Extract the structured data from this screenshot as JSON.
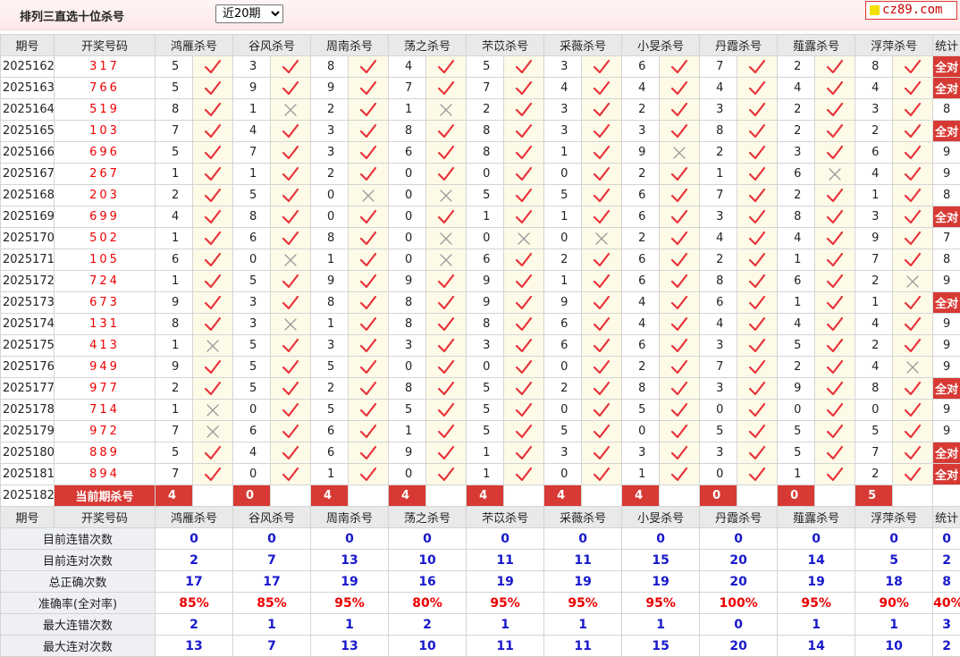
{
  "page": {
    "title": "排列三直选十位杀号",
    "period_select": "近20期",
    "logo": "cz89.com"
  },
  "columns": [
    "期号",
    "开奖号码",
    "鸿雁杀号",
    "谷风杀号",
    "周南杀号",
    "荡之杀号",
    "芣苡杀号",
    "采薇杀号",
    "小旻杀号",
    "丹霞杀号",
    "薤露杀号",
    "浮萍杀号",
    "统计"
  ],
  "rows": [
    {
      "period": "2025162",
      "draw": "317",
      "picks": [
        {
          "n": "5",
          "ok": true
        },
        {
          "n": "3",
          "ok": true
        },
        {
          "n": "8",
          "ok": true
        },
        {
          "n": "4",
          "ok": true
        },
        {
          "n": "5",
          "ok": true
        },
        {
          "n": "3",
          "ok": true
        },
        {
          "n": "6",
          "ok": true
        },
        {
          "n": "7",
          "ok": true
        },
        {
          "n": "2",
          "ok": true
        },
        {
          "n": "8",
          "ok": true
        }
      ],
      "total": "全对"
    },
    {
      "period": "2025163",
      "draw": "766",
      "picks": [
        {
          "n": "5",
          "ok": true
        },
        {
          "n": "9",
          "ok": true
        },
        {
          "n": "9",
          "ok": true
        },
        {
          "n": "7",
          "ok": true
        },
        {
          "n": "7",
          "ok": true
        },
        {
          "n": "4",
          "ok": true
        },
        {
          "n": "4",
          "ok": true
        },
        {
          "n": "4",
          "ok": true
        },
        {
          "n": "4",
          "ok": true
        },
        {
          "n": "4",
          "ok": true
        }
      ],
      "total": "全对"
    },
    {
      "period": "2025164",
      "draw": "519",
      "picks": [
        {
          "n": "8",
          "ok": true
        },
        {
          "n": "1",
          "ok": false
        },
        {
          "n": "2",
          "ok": true
        },
        {
          "n": "1",
          "ok": false
        },
        {
          "n": "2",
          "ok": true
        },
        {
          "n": "3",
          "ok": true
        },
        {
          "n": "2",
          "ok": true
        },
        {
          "n": "3",
          "ok": true
        },
        {
          "n": "2",
          "ok": true
        },
        {
          "n": "3",
          "ok": true
        }
      ],
      "total": "8"
    },
    {
      "period": "2025165",
      "draw": "103",
      "picks": [
        {
          "n": "7",
          "ok": true
        },
        {
          "n": "4",
          "ok": true
        },
        {
          "n": "3",
          "ok": true
        },
        {
          "n": "8",
          "ok": true
        },
        {
          "n": "8",
          "ok": true
        },
        {
          "n": "3",
          "ok": true
        },
        {
          "n": "3",
          "ok": true
        },
        {
          "n": "8",
          "ok": true
        },
        {
          "n": "2",
          "ok": true
        },
        {
          "n": "2",
          "ok": true
        }
      ],
      "total": "全对"
    },
    {
      "period": "2025166",
      "draw": "696",
      "picks": [
        {
          "n": "5",
          "ok": true
        },
        {
          "n": "7",
          "ok": true
        },
        {
          "n": "3",
          "ok": true
        },
        {
          "n": "6",
          "ok": true
        },
        {
          "n": "8",
          "ok": true
        },
        {
          "n": "1",
          "ok": true
        },
        {
          "n": "9",
          "ok": false
        },
        {
          "n": "2",
          "ok": true
        },
        {
          "n": "3",
          "ok": true
        },
        {
          "n": "6",
          "ok": true
        }
      ],
      "total": "9"
    },
    {
      "period": "2025167",
      "draw": "267",
      "picks": [
        {
          "n": "1",
          "ok": true
        },
        {
          "n": "1",
          "ok": true
        },
        {
          "n": "2",
          "ok": true
        },
        {
          "n": "0",
          "ok": true
        },
        {
          "n": "0",
          "ok": true
        },
        {
          "n": "0",
          "ok": true
        },
        {
          "n": "2",
          "ok": true
        },
        {
          "n": "1",
          "ok": true
        },
        {
          "n": "6",
          "ok": false
        },
        {
          "n": "4",
          "ok": true
        }
      ],
      "total": "9"
    },
    {
      "period": "2025168",
      "draw": "203",
      "picks": [
        {
          "n": "2",
          "ok": true
        },
        {
          "n": "5",
          "ok": true
        },
        {
          "n": "0",
          "ok": false
        },
        {
          "n": "0",
          "ok": false
        },
        {
          "n": "5",
          "ok": true
        },
        {
          "n": "5",
          "ok": true
        },
        {
          "n": "6",
          "ok": true
        },
        {
          "n": "7",
          "ok": true
        },
        {
          "n": "2",
          "ok": true
        },
        {
          "n": "1",
          "ok": true
        }
      ],
      "total": "8"
    },
    {
      "period": "2025169",
      "draw": "699",
      "picks": [
        {
          "n": "4",
          "ok": true
        },
        {
          "n": "8",
          "ok": true
        },
        {
          "n": "0",
          "ok": true
        },
        {
          "n": "0",
          "ok": true
        },
        {
          "n": "1",
          "ok": true
        },
        {
          "n": "1",
          "ok": true
        },
        {
          "n": "6",
          "ok": true
        },
        {
          "n": "3",
          "ok": true
        },
        {
          "n": "8",
          "ok": true
        },
        {
          "n": "3",
          "ok": true
        }
      ],
      "total": "全对"
    },
    {
      "period": "2025170",
      "draw": "502",
      "picks": [
        {
          "n": "1",
          "ok": true
        },
        {
          "n": "6",
          "ok": true
        },
        {
          "n": "8",
          "ok": true
        },
        {
          "n": "0",
          "ok": false
        },
        {
          "n": "0",
          "ok": false
        },
        {
          "n": "0",
          "ok": false
        },
        {
          "n": "2",
          "ok": true
        },
        {
          "n": "4",
          "ok": true
        },
        {
          "n": "4",
          "ok": true
        },
        {
          "n": "9",
          "ok": true
        }
      ],
      "total": "7"
    },
    {
      "period": "2025171",
      "draw": "105",
      "picks": [
        {
          "n": "6",
          "ok": true
        },
        {
          "n": "0",
          "ok": false
        },
        {
          "n": "1",
          "ok": true
        },
        {
          "n": "0",
          "ok": false
        },
        {
          "n": "6",
          "ok": true
        },
        {
          "n": "2",
          "ok": true
        },
        {
          "n": "6",
          "ok": true
        },
        {
          "n": "2",
          "ok": true
        },
        {
          "n": "1",
          "ok": true
        },
        {
          "n": "7",
          "ok": true
        }
      ],
      "total": "8"
    },
    {
      "period": "2025172",
      "draw": "724",
      "picks": [
        {
          "n": "1",
          "ok": true
        },
        {
          "n": "5",
          "ok": true
        },
        {
          "n": "9",
          "ok": true
        },
        {
          "n": "9",
          "ok": true
        },
        {
          "n": "9",
          "ok": true
        },
        {
          "n": "1",
          "ok": true
        },
        {
          "n": "6",
          "ok": true
        },
        {
          "n": "8",
          "ok": true
        },
        {
          "n": "6",
          "ok": true
        },
        {
          "n": "2",
          "ok": false
        }
      ],
      "total": "9"
    },
    {
      "period": "2025173",
      "draw": "673",
      "picks": [
        {
          "n": "9",
          "ok": true
        },
        {
          "n": "3",
          "ok": true
        },
        {
          "n": "8",
          "ok": true
        },
        {
          "n": "8",
          "ok": true
        },
        {
          "n": "9",
          "ok": true
        },
        {
          "n": "9",
          "ok": true
        },
        {
          "n": "4",
          "ok": true
        },
        {
          "n": "6",
          "ok": true
        },
        {
          "n": "1",
          "ok": true
        },
        {
          "n": "1",
          "ok": true
        }
      ],
      "total": "全对"
    },
    {
      "period": "2025174",
      "draw": "131",
      "picks": [
        {
          "n": "8",
          "ok": true
        },
        {
          "n": "3",
          "ok": false
        },
        {
          "n": "1",
          "ok": true
        },
        {
          "n": "8",
          "ok": true
        },
        {
          "n": "8",
          "ok": true
        },
        {
          "n": "6",
          "ok": true
        },
        {
          "n": "4",
          "ok": true
        },
        {
          "n": "4",
          "ok": true
        },
        {
          "n": "4",
          "ok": true
        },
        {
          "n": "4",
          "ok": true
        }
      ],
      "total": "9"
    },
    {
      "period": "2025175",
      "draw": "413",
      "picks": [
        {
          "n": "1",
          "ok": false
        },
        {
          "n": "5",
          "ok": true
        },
        {
          "n": "3",
          "ok": true
        },
        {
          "n": "3",
          "ok": true
        },
        {
          "n": "3",
          "ok": true
        },
        {
          "n": "6",
          "ok": true
        },
        {
          "n": "6",
          "ok": true
        },
        {
          "n": "3",
          "ok": true
        },
        {
          "n": "5",
          "ok": true
        },
        {
          "n": "2",
          "ok": true
        }
      ],
      "total": "9"
    },
    {
      "period": "2025176",
      "draw": "949",
      "picks": [
        {
          "n": "9",
          "ok": true
        },
        {
          "n": "5",
          "ok": true
        },
        {
          "n": "5",
          "ok": true
        },
        {
          "n": "0",
          "ok": true
        },
        {
          "n": "0",
          "ok": true
        },
        {
          "n": "0",
          "ok": true
        },
        {
          "n": "2",
          "ok": true
        },
        {
          "n": "7",
          "ok": true
        },
        {
          "n": "2",
          "ok": true
        },
        {
          "n": "4",
          "ok": false
        }
      ],
      "total": "9"
    },
    {
      "period": "2025177",
      "draw": "977",
      "picks": [
        {
          "n": "2",
          "ok": true
        },
        {
          "n": "5",
          "ok": true
        },
        {
          "n": "2",
          "ok": true
        },
        {
          "n": "8",
          "ok": true
        },
        {
          "n": "5",
          "ok": true
        },
        {
          "n": "2",
          "ok": true
        },
        {
          "n": "8",
          "ok": true
        },
        {
          "n": "3",
          "ok": true
        },
        {
          "n": "9",
          "ok": true
        },
        {
          "n": "8",
          "ok": true
        }
      ],
      "total": "全对"
    },
    {
      "period": "2025178",
      "draw": "714",
      "picks": [
        {
          "n": "1",
          "ok": false
        },
        {
          "n": "0",
          "ok": true
        },
        {
          "n": "5",
          "ok": true
        },
        {
          "n": "5",
          "ok": true
        },
        {
          "n": "5",
          "ok": true
        },
        {
          "n": "0",
          "ok": true
        },
        {
          "n": "5",
          "ok": true
        },
        {
          "n": "0",
          "ok": true
        },
        {
          "n": "0",
          "ok": true
        },
        {
          "n": "0",
          "ok": true
        }
      ],
      "total": "9"
    },
    {
      "period": "2025179",
      "draw": "972",
      "picks": [
        {
          "n": "7",
          "ok": false
        },
        {
          "n": "6",
          "ok": true
        },
        {
          "n": "6",
          "ok": true
        },
        {
          "n": "1",
          "ok": true
        },
        {
          "n": "5",
          "ok": true
        },
        {
          "n": "5",
          "ok": true
        },
        {
          "n": "0",
          "ok": true
        },
        {
          "n": "5",
          "ok": true
        },
        {
          "n": "5",
          "ok": true
        },
        {
          "n": "5",
          "ok": true
        }
      ],
      "total": "9"
    },
    {
      "period": "2025180",
      "draw": "889",
      "picks": [
        {
          "n": "5",
          "ok": true
        },
        {
          "n": "4",
          "ok": true
        },
        {
          "n": "6",
          "ok": true
        },
        {
          "n": "9",
          "ok": true
        },
        {
          "n": "1",
          "ok": true
        },
        {
          "n": "3",
          "ok": true
        },
        {
          "n": "3",
          "ok": true
        },
        {
          "n": "3",
          "ok": true
        },
        {
          "n": "5",
          "ok": true
        },
        {
          "n": "7",
          "ok": true
        }
      ],
      "total": "全对"
    },
    {
      "period": "2025181",
      "draw": "894",
      "picks": [
        {
          "n": "7",
          "ok": true
        },
        {
          "n": "0",
          "ok": true
        },
        {
          "n": "1",
          "ok": true
        },
        {
          "n": "0",
          "ok": true
        },
        {
          "n": "1",
          "ok": true
        },
        {
          "n": "0",
          "ok": true
        },
        {
          "n": "1",
          "ok": true
        },
        {
          "n": "0",
          "ok": true
        },
        {
          "n": "1",
          "ok": true
        },
        {
          "n": "2",
          "ok": true
        }
      ],
      "total": "全对"
    }
  ],
  "current": {
    "period": "2025182",
    "label": "当前期杀号",
    "values": [
      "4",
      "0",
      "4",
      "4",
      "4",
      "4",
      "4",
      "0",
      "0",
      "5"
    ]
  },
  "stats": [
    {
      "label": "目前连错次数",
      "values": [
        "0",
        "0",
        "0",
        "0",
        "0",
        "0",
        "0",
        "0",
        "0",
        "0"
      ],
      "total": "0",
      "red": false
    },
    {
      "label": "目前连对次数",
      "values": [
        "2",
        "7",
        "13",
        "10",
        "11",
        "11",
        "15",
        "20",
        "14",
        "5"
      ],
      "total": "2",
      "red": false
    },
    {
      "label": "总正确次数",
      "values": [
        "17",
        "17",
        "19",
        "16",
        "19",
        "19",
        "19",
        "20",
        "19",
        "18"
      ],
      "total": "8",
      "red": false
    },
    {
      "label": "准确率(全对率)",
      "values": [
        "85%",
        "85%",
        "95%",
        "80%",
        "95%",
        "95%",
        "95%",
        "100%",
        "95%",
        "90%"
      ],
      "total": "40%",
      "red": true
    },
    {
      "label": "最大连错次数",
      "values": [
        "2",
        "1",
        "1",
        "2",
        "1",
        "1",
        "1",
        "0",
        "1",
        "1"
      ],
      "total": "3",
      "red": false
    },
    {
      "label": "最大连对次数",
      "values": [
        "13",
        "7",
        "13",
        "10",
        "11",
        "11",
        "15",
        "20",
        "14",
        "10"
      ],
      "total": "2",
      "red": false
    }
  ],
  "colors": {
    "check": "#e8333a",
    "cross": "#9a9a9a",
    "full": "#d73a34",
    "stat": "#1919cc"
  }
}
